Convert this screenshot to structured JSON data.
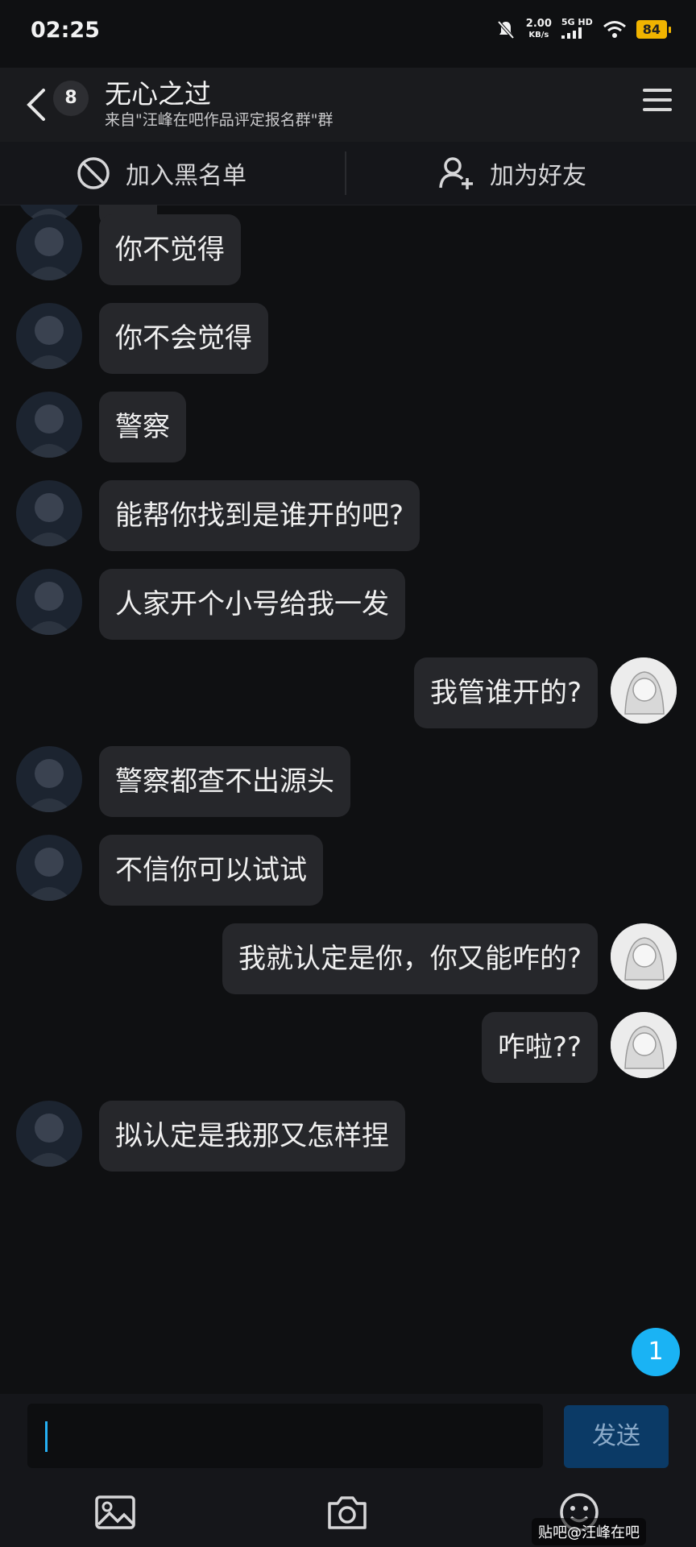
{
  "status_bar": {
    "time": "02:25",
    "speed_value": "2.00",
    "speed_unit": "KB/s",
    "network": "5G HD",
    "battery": "84"
  },
  "header": {
    "unread_count": "8",
    "title": "无心之过",
    "subtitle": "来自\"汪峰在吧作品评定报名群\"群"
  },
  "actions": {
    "block_label": "加入黑名单",
    "add_friend_label": "加为好友"
  },
  "messages": [
    {
      "side": "left",
      "text": "..."
    },
    {
      "side": "left",
      "text": "你不觉得"
    },
    {
      "side": "left",
      "text": "你不会觉得"
    },
    {
      "side": "left",
      "text": "警察"
    },
    {
      "side": "left",
      "text": "能帮你找到是谁开的吧?"
    },
    {
      "side": "left",
      "text": "人家开个小号给我一发"
    },
    {
      "side": "right",
      "text": "我管谁开的?"
    },
    {
      "side": "left",
      "text": "警察都查不出源头"
    },
    {
      "side": "left",
      "text": "不信你可以试试"
    },
    {
      "side": "right",
      "text": "我就认定是你，你又能咋的?"
    },
    {
      "side": "right",
      "text": "咋啦??"
    },
    {
      "side": "left",
      "text": "拟认定是我那又怎样捏"
    }
  ],
  "new_message_count": "1",
  "input": {
    "placeholder": "",
    "send_label": "发送"
  },
  "watermark": "贴吧@汪峰在吧",
  "colors": {
    "background": "#0f1012",
    "bubble": "#26272b",
    "send_button": "#0b3a66",
    "accent": "#1ab3f4"
  }
}
